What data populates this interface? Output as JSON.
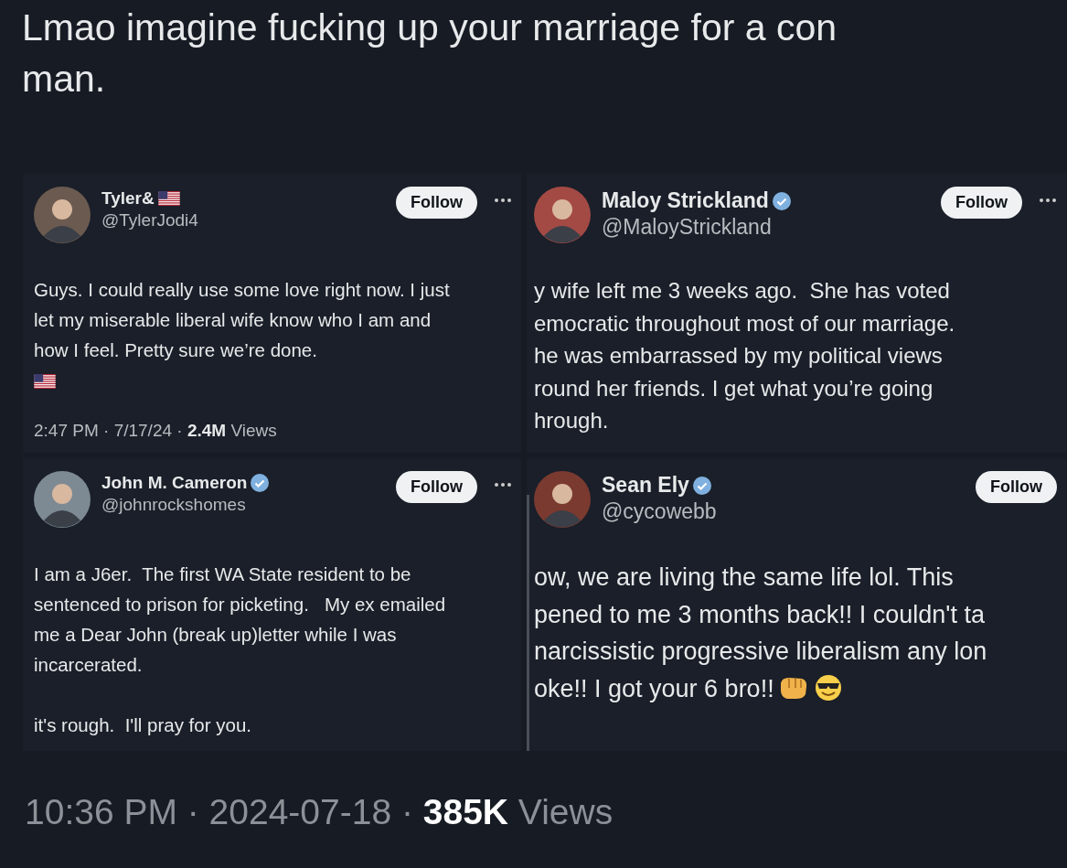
{
  "caption": "Lmao imagine fucking up your marriage for a con man.",
  "tweets": [
    {
      "name": "Tyler&",
      "name_flag": true,
      "verified": false,
      "handle": "@TylerJodi4",
      "follow": "Follow",
      "more": true,
      "lines": [
        "Guys. I could really use some love right now. I just",
        "let my miserable liberal wife know who I am and",
        "how I feel. Pretty sure we’re done."
      ],
      "body_flag": true,
      "trailing_emoji": false,
      "meta": "2:47 PM · 7/17/24 · **2.4M** Views"
    },
    {
      "name": "Maloy Strickland",
      "name_flag": false,
      "verified": true,
      "handle": "@MaloyStrickland",
      "follow": "Follow",
      "more": true,
      "lines": [
        "y wife left me 3 weeks ago.  She has voted",
        "emocratic throughout most of our marriage.",
        "he was embarrassed by my political views",
        "round her friends. I get what you’re going",
        "hrough."
      ],
      "body_flag": false,
      "trailing_emoji": false
    },
    {
      "name": "John M. Cameron",
      "name_flag": false,
      "verified": true,
      "handle": "@johnrockshomes",
      "follow": "Follow",
      "more": true,
      "lines": [
        "I am a J6er.  The first WA State resident to be",
        "sentenced to prison for picketing.   My ex emailed",
        "me a Dear John (break up)letter while I was",
        "incarcerated."
      ],
      "closing": "it's rough.  I'll pray for you.",
      "body_flag": false,
      "trailing_emoji": false
    },
    {
      "name": "Sean Ely",
      "name_flag": false,
      "verified": true,
      "handle": "@cycowebb",
      "follow": "Follow",
      "more": false,
      "lines": [
        "ow, we are living the same life lol. This",
        "pened to me 3 months back!! I couldn't ta",
        "narcissistic progressive liberalism any lon",
        "oke!! I got your 6 bro!!"
      ],
      "body_flag": false,
      "trailing_emoji": true
    }
  ],
  "footer": "10:36 PM · 2024-07-18 · **385K** Views"
}
